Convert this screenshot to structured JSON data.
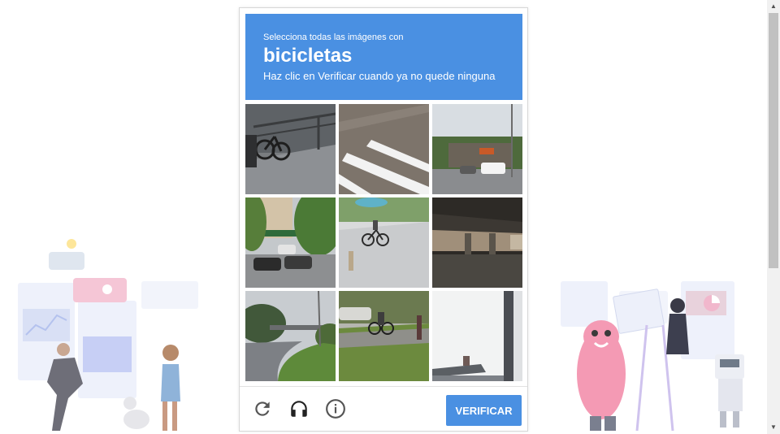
{
  "captcha": {
    "instruction_top": "Selecciona todas las imágenes con",
    "target_word": "bicicletas",
    "instruction_bottom": "Haz clic en Verificar cuando ya no quede ninguna",
    "header_color": "#4a90e2",
    "tiles": [
      {
        "scene": "bicycle parked by a railing"
      },
      {
        "scene": "road crosswalk markings"
      },
      {
        "scene": "street with storefront and cars"
      },
      {
        "scene": "parking lot with trees"
      },
      {
        "scene": "cyclist at intersection"
      },
      {
        "scene": "highway overpass"
      },
      {
        "scene": "road curve with trees"
      },
      {
        "scene": "cyclist on street"
      },
      {
        "scene": "overcast sky with boat"
      }
    ],
    "footer": {
      "reload_icon": "reload-icon",
      "audio_icon": "headphones-icon",
      "info_icon": "info-icon",
      "verify_label": "VERIFICAR"
    }
  },
  "scrollbar": {
    "up_arrow": "▲",
    "down_arrow": "▼"
  }
}
